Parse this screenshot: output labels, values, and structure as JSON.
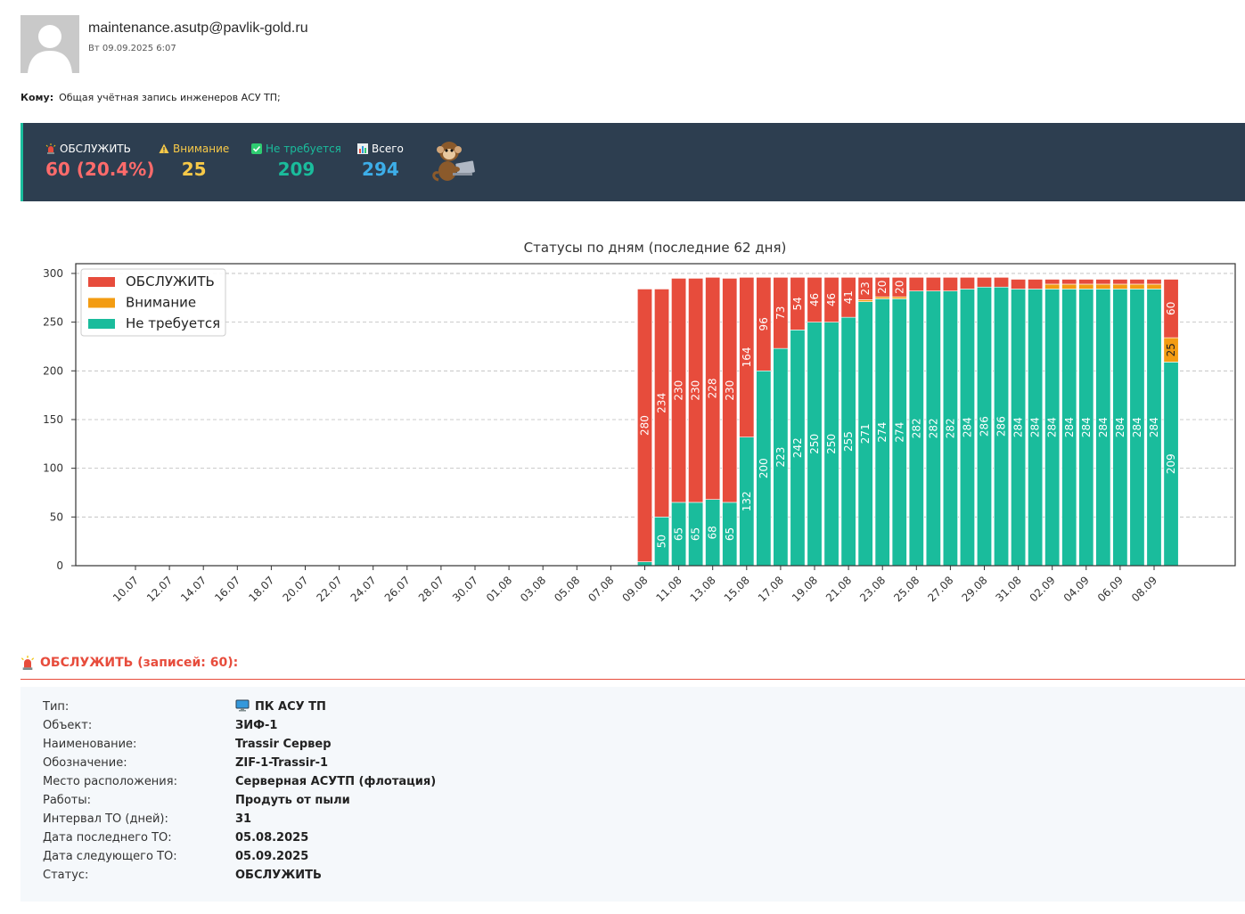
{
  "email": {
    "sender": "maintenance.asutp@pavlik-gold.ru",
    "date": "Вт 09.09.2025 6:07",
    "to_label": "Кому:",
    "to_value": "Общая учётная запись инженеров АСУ ТП;"
  },
  "stats": [
    {
      "icon": "siren-icon",
      "label": "ОБСЛУЖИТЬ",
      "value": "60 (20.4%)",
      "color": "#ff6b6b",
      "label_color": "#ffffff"
    },
    {
      "icon": "warning-icon",
      "label": "Внимание",
      "value": "25",
      "color": "#f7c948",
      "label_color": "#f7c948"
    },
    {
      "icon": "check-icon",
      "label": "Не требуется",
      "value": "209",
      "color": "#1abc9c",
      "label_color": "#1abc9c"
    },
    {
      "icon": "bar-chart-icon",
      "label": "Всего",
      "value": "294",
      "color": "#3daee9",
      "label_color": "#ffffff"
    }
  ],
  "mascot_icon": "monkey-laptop-icon",
  "chart_data": {
    "type": "bar",
    "stacked": true,
    "title": "Статусы по дням (последние 62 дня)",
    "ylim": [
      0,
      310
    ],
    "yticks": [
      0,
      50,
      100,
      150,
      200,
      250,
      300
    ],
    "xtick_labels": [
      "10.07",
      "12.07",
      "14.07",
      "16.07",
      "18.07",
      "20.07",
      "22.07",
      "24.07",
      "26.07",
      "28.07",
      "30.07",
      "01.08",
      "03.08",
      "05.08",
      "07.08",
      "09.08",
      "11.08",
      "13.08",
      "15.08",
      "17.08",
      "19.08",
      "21.08",
      "23.08",
      "25.08",
      "27.08",
      "29.08",
      "31.08",
      "02.09",
      "04.09",
      "06.09",
      "08.09"
    ],
    "grid": true,
    "legend_position": "top-left",
    "colors": {
      "serve": "#e74c3c",
      "attention": "#f39c12",
      "ok": "#1abc9c"
    },
    "categories": [
      "09.08",
      "10.08",
      "11.08",
      "12.08",
      "13.08",
      "14.08",
      "15.08",
      "16.08",
      "17.08",
      "18.08",
      "19.08",
      "20.08",
      "21.08",
      "22.08",
      "23.08",
      "24.08",
      "25.08",
      "26.08",
      "27.08",
      "28.08",
      "29.08",
      "30.08",
      "31.08",
      "01.09",
      "02.09",
      "03.09",
      "04.09",
      "05.09",
      "06.09",
      "07.09",
      "08.09",
      "09.09"
    ],
    "series": [
      {
        "name": "ОБСЛУЖИТЬ",
        "key": "serve",
        "values": [
          280,
          234,
          230,
          230,
          228,
          230,
          164,
          96,
          73,
          54,
          46,
          46,
          41,
          23,
          20,
          20,
          14,
          14,
          14,
          12,
          10,
          10,
          10,
          10,
          5,
          5,
          5,
          5,
          5,
          5,
          5,
          60
        ]
      },
      {
        "name": "Внимание",
        "key": "attention",
        "values": [
          0,
          0,
          0,
          0,
          0,
          0,
          0,
          0,
          0,
          0,
          0,
          0,
          0,
          2,
          2,
          2,
          0,
          0,
          0,
          0,
          0,
          0,
          0,
          0,
          5,
          5,
          5,
          5,
          5,
          5,
          5,
          25
        ]
      },
      {
        "name": "Не требуется",
        "key": "ok",
        "values": [
          4,
          50,
          65,
          65,
          68,
          65,
          132,
          200,
          223,
          242,
          250,
          250,
          255,
          271,
          274,
          274,
          282,
          282,
          282,
          284,
          286,
          286,
          284,
          284,
          284,
          284,
          284,
          284,
          284,
          284,
          284,
          209
        ]
      }
    ],
    "bar_labels": {
      "serve": [
        280,
        234,
        230,
        230,
        228,
        230,
        164,
        96,
        73,
        54,
        46,
        46,
        41,
        23,
        20,
        20,
        null,
        null,
        null,
        null,
        null,
        null,
        null,
        null,
        null,
        null,
        null,
        null,
        null,
        null,
        null,
        60
      ],
      "attention": [
        null,
        null,
        null,
        null,
        null,
        null,
        null,
        null,
        null,
        null,
        null,
        null,
        null,
        null,
        null,
        null,
        null,
        null,
        null,
        null,
        null,
        null,
        null,
        null,
        null,
        null,
        null,
        null,
        null,
        null,
        null,
        25
      ],
      "ok": [
        null,
        50,
        65,
        65,
        68,
        65,
        132,
        200,
        223,
        242,
        250,
        250,
        255,
        271,
        274,
        274,
        282,
        282,
        282,
        284,
        286,
        286,
        284,
        284,
        284,
        284,
        284,
        284,
        284,
        284,
        284,
        209
      ]
    }
  },
  "section": {
    "icon": "siren-icon",
    "title": "ОБСЛУЖИТЬ (записей: 60):"
  },
  "record": {
    "type_icon": "computer-icon",
    "rows": [
      {
        "key": "Тип:",
        "value": "ПК АСУ ТП"
      },
      {
        "key": "Объект:",
        "value": "ЗИФ-1"
      },
      {
        "key": "Наименование:",
        "value": "Trassir Сервер"
      },
      {
        "key": "Обозначение:",
        "value": "ZIF-1-Trassir-1"
      },
      {
        "key": "Место расположения:",
        "value": "Серверная АСУТП (флотация)"
      },
      {
        "key": "Работы:",
        "value": "Продуть от пыли"
      },
      {
        "key": "Интервал ТО (дней):",
        "value": "31"
      },
      {
        "key": "Дата последнего ТО:",
        "value": "05.08.2025"
      },
      {
        "key": "Дата следующего ТО:",
        "value": "05.09.2025"
      },
      {
        "key": "Статус:",
        "value": "ОБСЛУЖИТЬ"
      }
    ]
  }
}
